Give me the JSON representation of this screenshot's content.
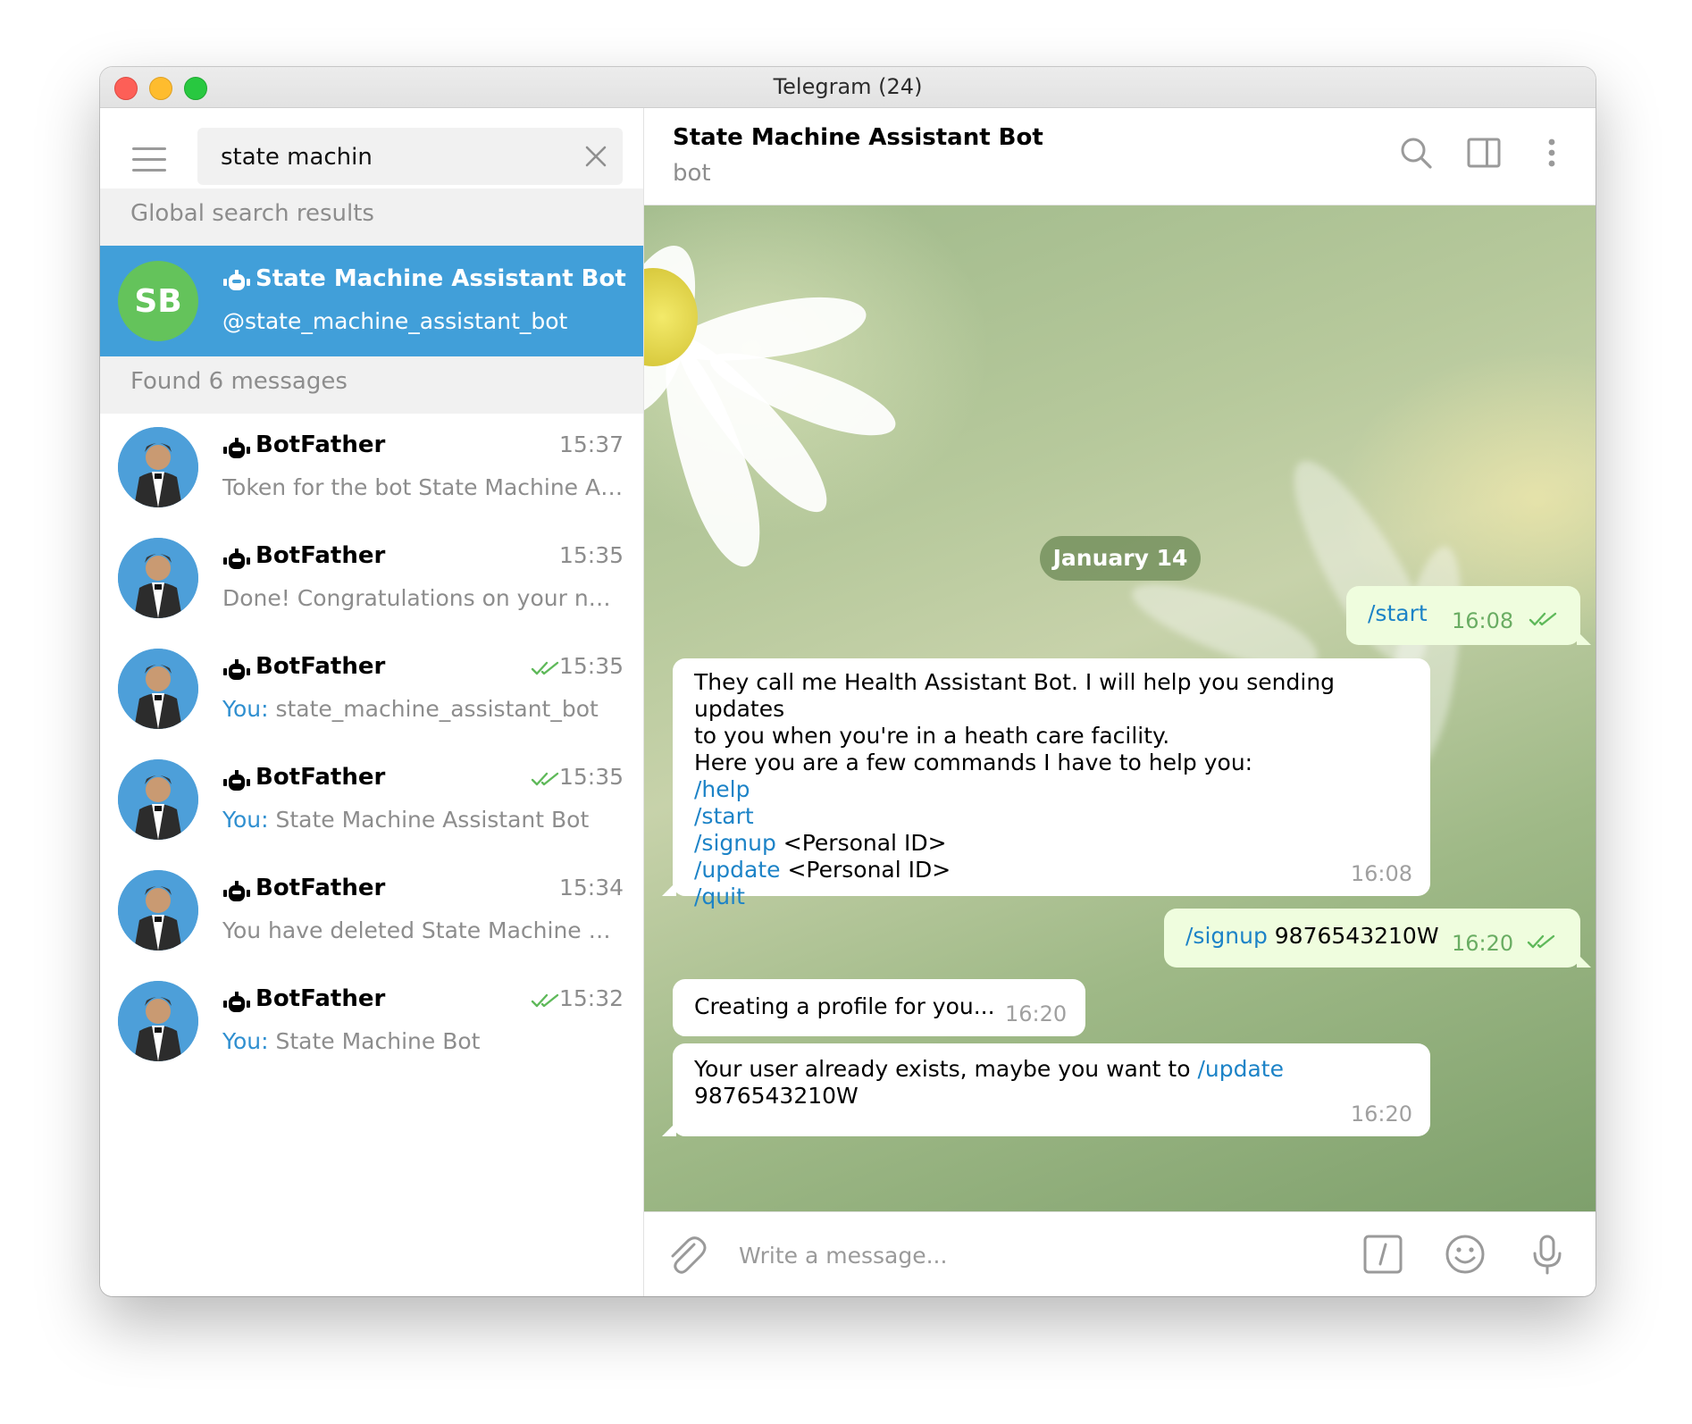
{
  "window": {
    "title": "Telegram (24)"
  },
  "search": {
    "query": "state machin"
  },
  "sidebar": {
    "global_header": "Global search results",
    "global_result": {
      "avatar_initials": "SB",
      "avatar_color": "#64c35b",
      "name": "State Machine Assistant Bot",
      "username": "@state_machine_assistant_bot"
    },
    "found_header": "Found 6 messages",
    "messages": [
      {
        "name": "BotFather",
        "time": "15:37",
        "you": "",
        "text": "Token for the bot State Machine Assistant Bot"
      },
      {
        "name": "BotFather",
        "time": "15:35",
        "you": "",
        "text": "Done! Congratulations on your new bot."
      },
      {
        "name": "BotFather",
        "time": "15:35",
        "you": "You:",
        "text": "state_machine_assistant_bot"
      },
      {
        "name": "BotFather",
        "time": "15:35",
        "you": "You:",
        "text": "State Machine Assistant Bot"
      },
      {
        "name": "BotFather",
        "time": "15:34",
        "you": "",
        "text": "You have deleted State Machine Bot."
      },
      {
        "name": "BotFather",
        "time": "15:32",
        "you": "You:",
        "text": "State Machine Bot"
      }
    ]
  },
  "chat": {
    "title": "State Machine Assistant Bot",
    "status": "bot",
    "date": "January 14",
    "messages": {
      "m1": {
        "cmd": "/start",
        "time": "16:08"
      },
      "m2": {
        "line1": "They call me Health Assistant Bot. I will help you sending updates",
        "line2": "to you when you're in a heath care facility.",
        "line3": "Here you are a few commands I have to help you:",
        "cmd_help": "/help",
        "cmd_start": "/start",
        "cmd_signup": "/signup",
        "signup_arg": " <Personal ID>",
        "cmd_update": "/update",
        "update_arg": " <Personal ID>",
        "cmd_quit": "/quit",
        "time": "16:08"
      },
      "m3": {
        "cmd": "/signup",
        "arg": " 9876543210W",
        "time": "16:20"
      },
      "m4": {
        "text": "Creating a profile for you...",
        "time": "16:20"
      },
      "m5": {
        "text": "Your user already exists, maybe you want to ",
        "cmd": "/update",
        "line2": "9876543210W",
        "time": "16:20"
      }
    }
  },
  "composer": {
    "placeholder": "Write a message..."
  },
  "colors": {
    "accent": "#419fd9",
    "link": "#1c83c7",
    "out_bubble": "#effdde",
    "read_check": "#5fb95a"
  },
  "icons": [
    "menu-icon",
    "close-icon",
    "bot-icon",
    "double-check-icon",
    "search-icon",
    "sidebar-toggle-icon",
    "more-icon",
    "paperclip-icon",
    "slash-command-icon",
    "emoji-icon",
    "microphone-icon"
  ]
}
